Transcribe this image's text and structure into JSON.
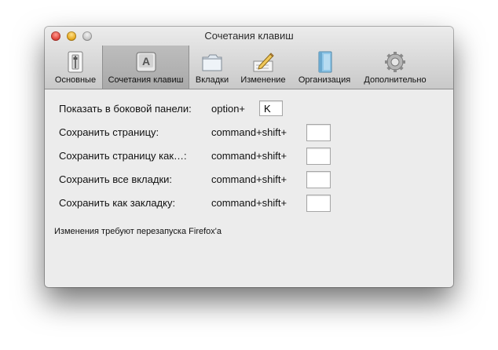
{
  "window": {
    "title": "Сочетания клавиш"
  },
  "toolbar": {
    "items": [
      {
        "label": "Основные",
        "icon": "light-switch-icon",
        "selected": false
      },
      {
        "label": "Сочетания клавиш",
        "icon": "keyboard-key-icon",
        "selected": true
      },
      {
        "label": "Вкладки",
        "icon": "folder-tabs-icon",
        "selected": false
      },
      {
        "label": "Изменение",
        "icon": "pencil-paper-icon",
        "selected": false
      },
      {
        "label": "Организация",
        "icon": "book-icon",
        "selected": false
      },
      {
        "label": "Дополнительно",
        "icon": "gear-icon",
        "selected": false
      }
    ]
  },
  "shortcuts": [
    {
      "label": "Показать в боковой панели:",
      "modifier": "option+",
      "key": "K"
    },
    {
      "label": "Сохранить страницу:",
      "modifier": "command+shift+",
      "key": ""
    },
    {
      "label": "Сохранить страницу как…:",
      "modifier": "command+shift+",
      "key": ""
    },
    {
      "label": "Сохранить все вкладки:",
      "modifier": "command+shift+",
      "key": ""
    },
    {
      "label": "Сохранить как закладку:",
      "modifier": "command+shift+",
      "key": ""
    }
  ],
  "note": "Изменения требуют перезапуска Firefox'a"
}
